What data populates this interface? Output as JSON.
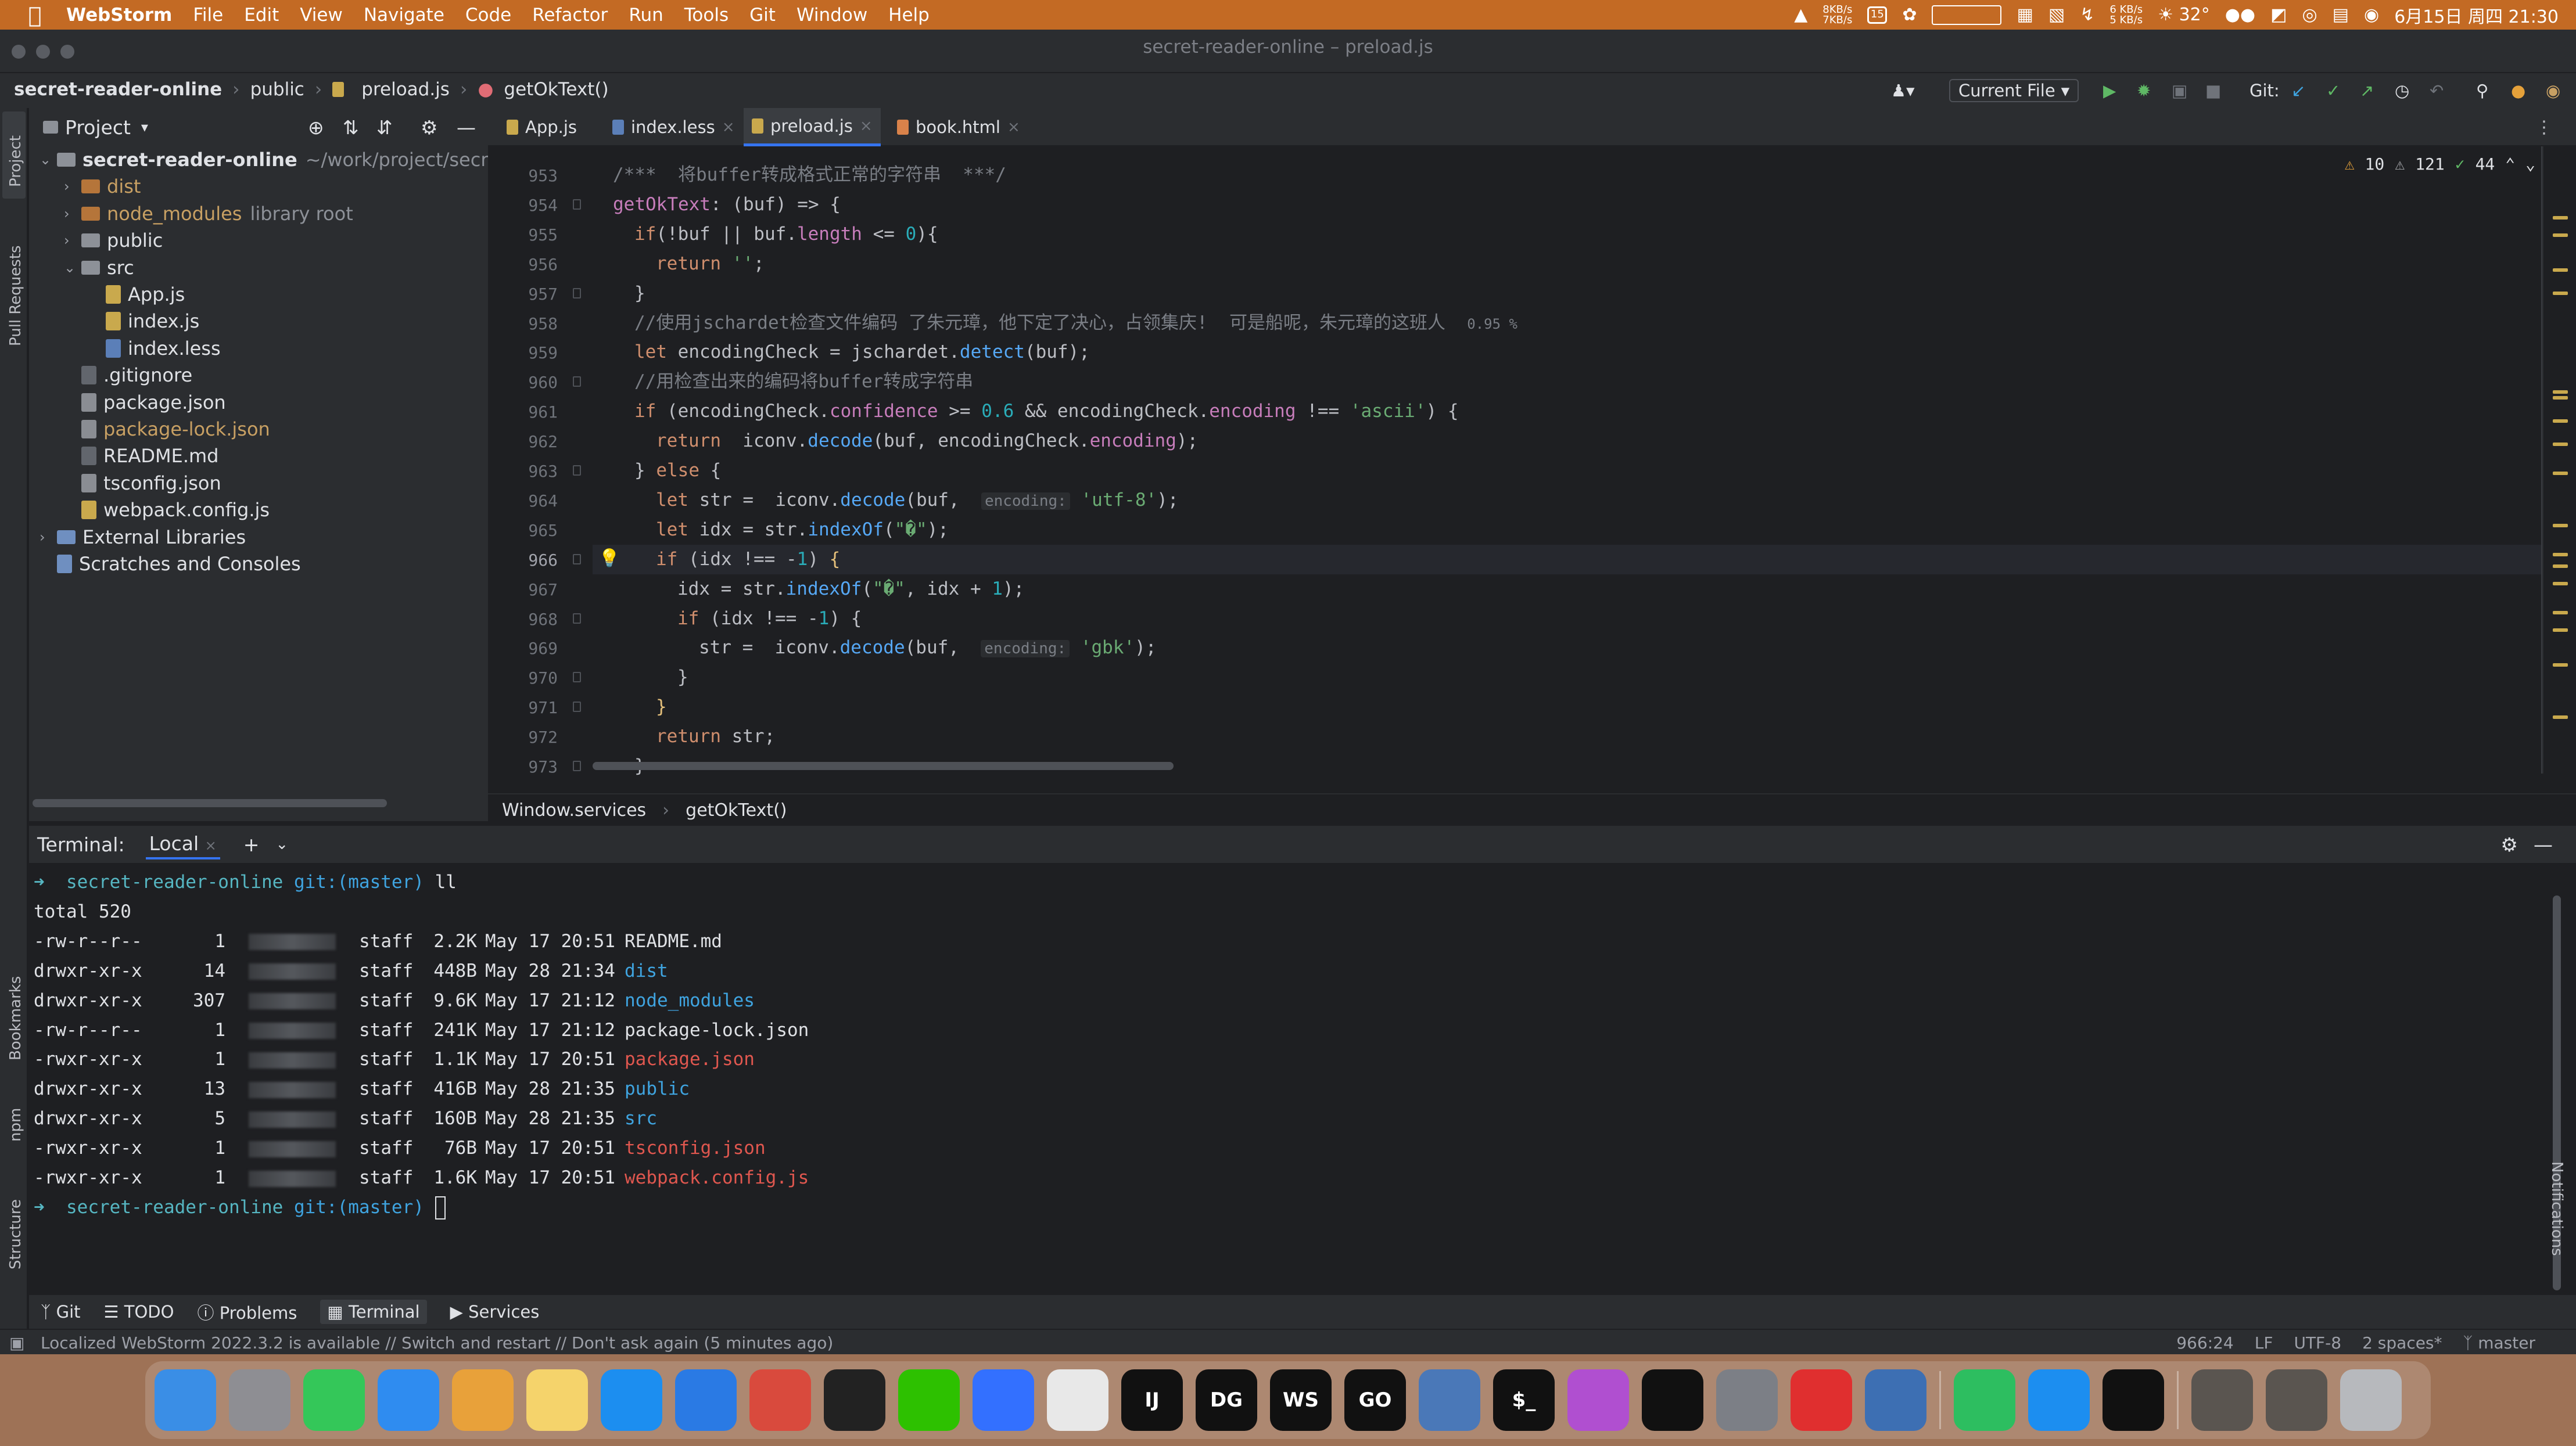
{
  "menubar": {
    "app": "WebStorm",
    "items": [
      "File",
      "Edit",
      "View",
      "Navigate",
      "Code",
      "Refactor",
      "Run",
      "Tools",
      "Git",
      "Window",
      "Help"
    ],
    "net_up": "8KB/s",
    "net_down": "7KB/s",
    "net2_up": "6 KB/s",
    "net2_down": "5 KB/s",
    "temp": "32°",
    "datetime": "6月15日 周四 21:30",
    "calendar_day": "15"
  },
  "window": {
    "title": "secret-reader-online – preload.js"
  },
  "breadcrumb": [
    "secret-reader-online",
    "public",
    "preload.js",
    "getOkText()"
  ],
  "toolbar": {
    "run_config": "Current File",
    "git_label": "Git:"
  },
  "project": {
    "header": "Project",
    "tree": [
      {
        "label": "secret-reader-online",
        "suffix": "~/work/project/secret-r",
        "depth": 0,
        "type": "folder",
        "expanded": true
      },
      {
        "label": "dist",
        "depth": 1,
        "type": "folder-orange",
        "expanded": false
      },
      {
        "label": "node_modules",
        "suffix": "library root",
        "depth": 1,
        "type": "folder-orange",
        "expanded": false
      },
      {
        "label": "public",
        "depth": 1,
        "type": "folder",
        "expanded": false
      },
      {
        "label": "src",
        "depth": 1,
        "type": "folder",
        "expanded": true
      },
      {
        "label": "App.js",
        "depth": 2,
        "type": "js"
      },
      {
        "label": "index.js",
        "depth": 2,
        "type": "js"
      },
      {
        "label": "index.less",
        "depth": 2,
        "type": "less"
      },
      {
        "label": ".gitignore",
        "depth": 1,
        "type": "file"
      },
      {
        "label": "package.json",
        "depth": 1,
        "type": "json"
      },
      {
        "label": "package-lock.json",
        "depth": 1,
        "type": "json-orange"
      },
      {
        "label": "README.md",
        "depth": 1,
        "type": "file"
      },
      {
        "label": "tsconfig.json",
        "depth": 1,
        "type": "json"
      },
      {
        "label": "webpack.config.js",
        "depth": 1,
        "type": "js"
      },
      {
        "label": "External Libraries",
        "depth": 0,
        "type": "lib",
        "expanded": false
      },
      {
        "label": "Scratches and Consoles",
        "depth": 0,
        "type": "scratch"
      }
    ]
  },
  "tabs": [
    {
      "label": "App.js",
      "active": false
    },
    {
      "label": "index.less",
      "active": false
    },
    {
      "label": "preload.js",
      "active": true
    },
    {
      "label": "book.html",
      "active": false
    }
  ],
  "inspections": {
    "warnings": "10",
    "weak": "121",
    "typos": "44"
  },
  "editor": {
    "lines": [
      {
        "n": "953",
        "html": "<span class=\"cm\">/***  将buffer转成格式正常的字符串  ***/</span>",
        "indent": 0
      },
      {
        "n": "954",
        "html": "<span class=\"prop\">getOkText</span>: (buf) => {",
        "indent": 0
      },
      {
        "n": "955",
        "html": "<span class=\"kw\">if</span>(!buf || buf.<span class=\"prop\">length</span> <= <span class=\"num\">0</span>){",
        "indent": 1
      },
      {
        "n": "956",
        "html": "<span class=\"kw\">return</span> <span class=\"str\">''</span>;",
        "indent": 2
      },
      {
        "n": "957",
        "html": "}",
        "indent": 1
      },
      {
        "n": "958",
        "html": "<span class=\"cm\">//使用jschardet检查文件编码 了朱元璋，他下定了决心，占领集庆!  可是船呢，朱元璋的这班人</span>  <span class=\"cm\" style=\"font-size:24px\">0.95 %</span>",
        "indent": 1
      },
      {
        "n": "959",
        "html": "<span class=\"kw\">let</span> encodingCheck = jschardet.<span class=\"fn\">detect</span>(buf);",
        "indent": 1
      },
      {
        "n": "960",
        "html": "<span class=\"cm\">//用检查出来的编码将buffer转成字符串</span>",
        "indent": 1
      },
      {
        "n": "961",
        "html": "<span class=\"kw\">if</span> (encodingCheck.<span class=\"prop\">confidence</span> >= <span class=\"num\">0.6</span> && encodingCheck.<span class=\"prop\">encoding</span> !== <span class=\"str\">'ascii'</span>) {",
        "indent": 1
      },
      {
        "n": "962",
        "html": "<span class=\"kw\">return</span>  iconv.<span class=\"fn\">decode</span>(buf, encodingCheck.<span class=\"prop\">encoding</span>);",
        "indent": 2
      },
      {
        "n": "963",
        "html": "} <span class=\"kw\">else</span> {",
        "indent": 1
      },
      {
        "n": "964",
        "html": "<span class=\"kw\">let</span> str =  iconv.<span class=\"fn\">decode</span>(buf,  <span class=\"hint\">encoding:</span> <span class=\"str\">'utf-8'</span>);",
        "indent": 2
      },
      {
        "n": "965",
        "html": "<span class=\"kw\">let</span> idx = str.<span class=\"fn\">indexOf</span>(<span class=\"str\">\"�\"</span>);",
        "indent": 2
      },
      {
        "n": "966",
        "html": "<span class=\"kw\">if</span> (idx !== -<span class=\"num\">1</span>) <span style=\"color:#e5c07b\">{</span>",
        "indent": 2,
        "current": true
      },
      {
        "n": "967",
        "html": "idx = str.<span class=\"fn\">indexOf</span>(<span class=\"str\">\"�\"</span>, idx + <span class=\"num\">1</span>);",
        "indent": 3
      },
      {
        "n": "968",
        "html": "<span class=\"kw\">if</span> (idx !== -<span class=\"num\">1</span>) {",
        "indent": 3
      },
      {
        "n": "969",
        "html": "str =  iconv.<span class=\"fn\">decode</span>(buf,  <span class=\"hint\">encoding:</span> <span class=\"str\">'gbk'</span>);",
        "indent": 4
      },
      {
        "n": "970",
        "html": "}",
        "indent": 3
      },
      {
        "n": "971",
        "html": "<span style=\"color:#e5c07b\">}</span>",
        "indent": 2
      },
      {
        "n": "972",
        "html": "<span class=\"kw\">return</span> str;",
        "indent": 2
      },
      {
        "n": "973",
        "html": "}",
        "indent": 1
      }
    ]
  },
  "editor_breadcrumb": [
    "Window.services",
    "getOkText()"
  ],
  "terminal": {
    "header_label": "Terminal:",
    "tab": "Local",
    "prompt_dir": "secret-reader-online",
    "prompt_git": "git:(master)",
    "command": "ll",
    "total": "total 520",
    "rows": [
      {
        "perm": "-rw-r--r--",
        "links": "1",
        "group": "staff",
        "size": "2.2K",
        "date": "May 17 20:51",
        "name": "README.md",
        "color": "plain"
      },
      {
        "perm": "drwxr-xr-x",
        "links": "14",
        "group": "staff",
        "size": "448B",
        "date": "May 28 21:34",
        "name": "dist",
        "color": "blue"
      },
      {
        "perm": "drwxr-xr-x",
        "links": "307",
        "group": "staff",
        "size": "9.6K",
        "date": "May 17 21:12",
        "name": "node_modules",
        "color": "blue"
      },
      {
        "perm": "-rw-r--r--",
        "links": "1",
        "group": "staff",
        "size": "241K",
        "date": "May 17 21:12",
        "name": "package-lock.json",
        "color": "plain"
      },
      {
        "perm": "-rwxr-xr-x",
        "links": "1",
        "group": "staff",
        "size": "1.1K",
        "date": "May 17 20:51",
        "name": "package.json",
        "color": "red"
      },
      {
        "perm": "drwxr-xr-x",
        "links": "13",
        "group": "staff",
        "size": "416B",
        "date": "May 28 21:35",
        "name": "public",
        "color": "blue"
      },
      {
        "perm": "drwxr-xr-x",
        "links": "5",
        "group": "staff",
        "size": "160B",
        "date": "May 28 21:35",
        "name": "src",
        "color": "blue"
      },
      {
        "perm": "-rwxr-xr-x",
        "links": "1",
        "group": "staff",
        "size": "76B",
        "date": "May 17 20:51",
        "name": "tsconfig.json",
        "color": "red"
      },
      {
        "perm": "-rwxr-xr-x",
        "links": "1",
        "group": "staff",
        "size": "1.6K",
        "date": "May 17 20:51",
        "name": "webpack.config.js",
        "color": "red"
      }
    ]
  },
  "bottom_tabs": [
    "Git",
    "TODO",
    "Problems",
    "Terminal",
    "Services"
  ],
  "left_strip": [
    "Project",
    "Pull Requests",
    "Bookmarks",
    "npm",
    "Structure"
  ],
  "right_strip": [
    "Notifications"
  ],
  "status": {
    "message": "Localized WebStorm 2022.3.2 is available // Switch and restart // Don't ask again (5 minutes ago)",
    "position": "966:24",
    "line_sep": "LF",
    "encoding": "UTF-8",
    "indent": "2 spaces*",
    "branch": "master"
  },
  "dock": [
    {
      "name": "finder-icon",
      "label": "",
      "color": "#3a8ee6"
    },
    {
      "name": "launchpad-icon",
      "label": "",
      "color": "#8e8e93"
    },
    {
      "name": "messages-icon",
      "label": "",
      "color": "#34c759"
    },
    {
      "name": "mail-icon",
      "label": "",
      "color": "#2f8cf0"
    },
    {
      "name": "photos-icon",
      "label": "",
      "color": "#e8a13a"
    },
    {
      "name": "notes-icon",
      "label": "",
      "color": "#f5d36b"
    },
    {
      "name": "app-store-icon",
      "label": "",
      "color": "#1c8ef0"
    },
    {
      "name": "safari-icon",
      "label": "",
      "color": "#2a7ae4"
    },
    {
      "name": "chrome-icon",
      "label": "",
      "color": "#d94a3d"
    },
    {
      "name": "qq-icon",
      "label": "",
      "color": "#222"
    },
    {
      "name": "wechat-icon",
      "label": "",
      "color": "#2dc100"
    },
    {
      "name": "feishu-icon",
      "label": "",
      "color": "#3370ff"
    },
    {
      "name": "chat-icon",
      "label": "",
      "color": "#e8e8e8"
    },
    {
      "name": "intellij-icon",
      "label": "IJ",
      "color": "#111"
    },
    {
      "name": "datagrip-icon",
      "label": "DG",
      "color": "#111"
    },
    {
      "name": "webstorm-icon",
      "label": "WS",
      "color": "#111"
    },
    {
      "name": "goland-icon",
      "label": "GO",
      "color": "#111"
    },
    {
      "name": "stack-icon",
      "label": "",
      "color": "#4a78b8"
    },
    {
      "name": "terminal-icon",
      "label": "$_",
      "color": "#111"
    },
    {
      "name": "daisy-icon",
      "label": "",
      "color": "#b04fd0"
    },
    {
      "name": "activity-monitor-icon",
      "label": "",
      "color": "#111"
    },
    {
      "name": "system-settings-icon",
      "label": "",
      "color": "#7c7f86"
    },
    {
      "name": "netease-music-icon",
      "label": "",
      "color": "#e02f2f"
    },
    {
      "name": "remote-desktop-icon",
      "label": "",
      "color": "#3d6fb3"
    },
    {
      "name": "evernote-icon",
      "label": "",
      "color": "#2dbe60"
    },
    {
      "name": "xcode-icon",
      "label": "",
      "color": "#1c8ef0"
    },
    {
      "name": "tux-icon",
      "label": "",
      "color": "#111"
    },
    {
      "name": "folder-stack-icon",
      "label": "",
      "color": "#5a5550"
    },
    {
      "name": "downloads-stack-icon",
      "label": "",
      "color": "#5a5550"
    },
    {
      "name": "trash-icon",
      "label": "",
      "color": "#b7b9bd"
    }
  ],
  "colors": {
    "accent": "#3574f0",
    "menubar": "#c36a24"
  }
}
